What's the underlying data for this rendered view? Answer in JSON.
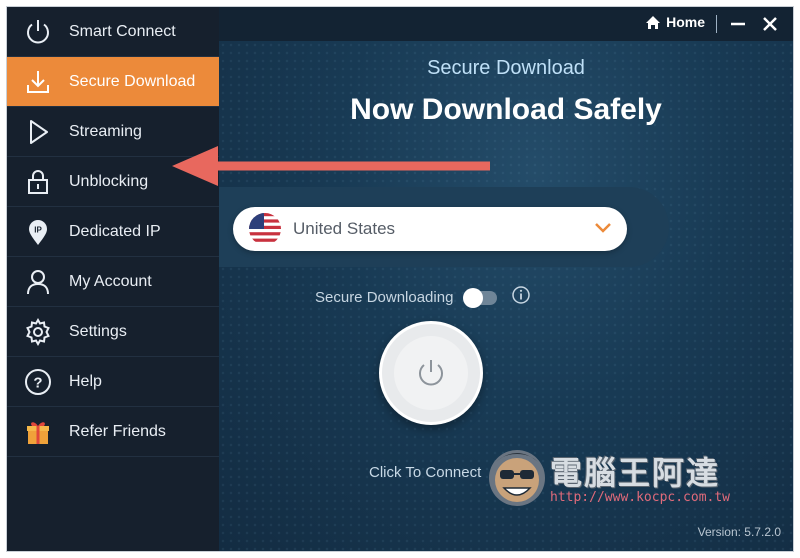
{
  "sidebar": {
    "items": [
      {
        "label": "Smart Connect",
        "icon": "power-icon",
        "active": false
      },
      {
        "label": "Secure Download",
        "icon": "download-icon",
        "active": true
      },
      {
        "label": "Streaming",
        "icon": "play-icon",
        "active": false
      },
      {
        "label": "Unblocking",
        "icon": "lock-icon",
        "active": false
      },
      {
        "label": "Dedicated IP",
        "icon": "ip-pin-icon",
        "active": false
      },
      {
        "label": "My Account",
        "icon": "user-icon",
        "active": false
      },
      {
        "label": "Settings",
        "icon": "gear-icon",
        "active": false
      },
      {
        "label": "Help",
        "icon": "help-icon",
        "active": false
      },
      {
        "label": "Refer Friends",
        "icon": "gift-icon",
        "active": false
      }
    ]
  },
  "titlebar": {
    "home_label": "Home"
  },
  "main": {
    "subtitle": "Secure Download",
    "headline": "Now Download Safely",
    "location": "United States",
    "toggle_label": "Secure Downloading",
    "toggle_on": false,
    "connect_label": "Click To Connect",
    "version": "Version:  5.7.2.0"
  },
  "watermark": {
    "title": "電腦王阿達",
    "url": "http://www.kocpc.com.tw"
  },
  "colors": {
    "accent": "#ec8a3a",
    "sidebar_bg": "#16202d",
    "main_bg": "#183a54",
    "arrow": "#e8685e"
  }
}
